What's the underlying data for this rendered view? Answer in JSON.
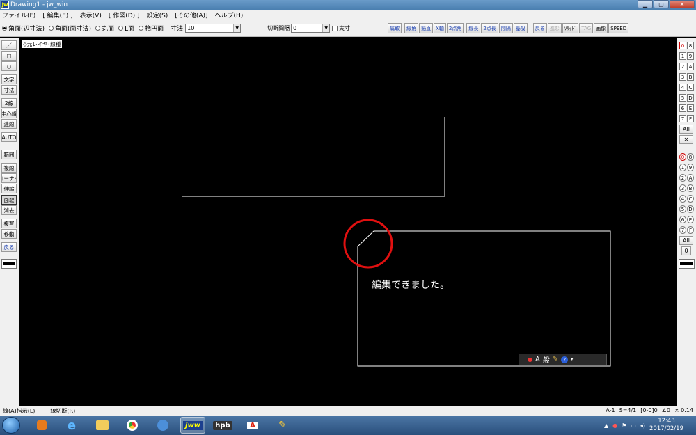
{
  "window": {
    "title": "Drawing1 - jw_win",
    "logo": "jw"
  },
  "menubar": [
    "ファイル(F)",
    "[ 編集(E) ]",
    "表示(V)",
    "[ 作図(D) ]",
    "設定(S)",
    "[その他(A)]",
    "ヘルプ(H)"
  ],
  "toolbar": {
    "radios": [
      {
        "label": "角面(辺寸法)",
        "checked": true
      },
      {
        "label": "角面(面寸法)",
        "checked": false
      },
      {
        "label": "丸面",
        "checked": false
      },
      {
        "label": "L面",
        "checked": false
      },
      {
        "label": "楕円面",
        "checked": false
      }
    ],
    "dimension_label": "寸法",
    "dimension_value": "10",
    "cut_interval_label": "切断間隔",
    "cut_interval_value": "0",
    "actual_size_label": "実寸",
    "buttons": [
      "属取",
      "線角",
      "鉛直",
      "X軸",
      "2点角",
      "線長",
      "2点長",
      "間隔",
      "基設"
    ],
    "buttons2": [
      "戻る",
      "進む",
      "ｿﾘｯﾄﾞ",
      "TAG",
      "画像",
      "SPEED"
    ]
  },
  "leftbar": {
    "tools": [
      "／",
      "□",
      "○",
      "文字",
      "寸法",
      "2線",
      "中心線",
      "連線",
      "AUTO",
      "範囲",
      "複線",
      "コーナー",
      "伸縮",
      "面取",
      "消去",
      "複写",
      "移動",
      "戻る"
    ]
  },
  "rightbar": {
    "layer_groups": [
      "0",
      "8",
      "1",
      "9",
      "2",
      "A",
      "3",
      "B",
      "4",
      "C",
      "5",
      "D",
      "6",
      "E",
      "7",
      "F"
    ],
    "all_label": "All",
    "zero_label": "0"
  },
  "canvas": {
    "layer_label": "◇元レイヤ･線種",
    "message": "編集できました。",
    "ime_label": "般"
  },
  "statusbar": {
    "left": "線(A)指示(L)",
    "mid": "線切断(R)",
    "paper": "A-1",
    "scale": "S=4/1",
    "layer": "[0-0]0",
    "angle": "∠0",
    "factor": "× 0.14"
  },
  "taskbar": {
    "apps": [
      "media-icon",
      "ie-icon",
      "explorer-icon",
      "chrome-icon",
      "thunderbird-icon",
      "jww-icon",
      "hpb-icon",
      "acrobat-icon",
      "paint-icon"
    ],
    "time": "12:43",
    "date": "2017/02/19"
  },
  "colors": {
    "annotation_circle": "#e01010",
    "canvas_bg": "#000000",
    "line": "#ffffff"
  }
}
